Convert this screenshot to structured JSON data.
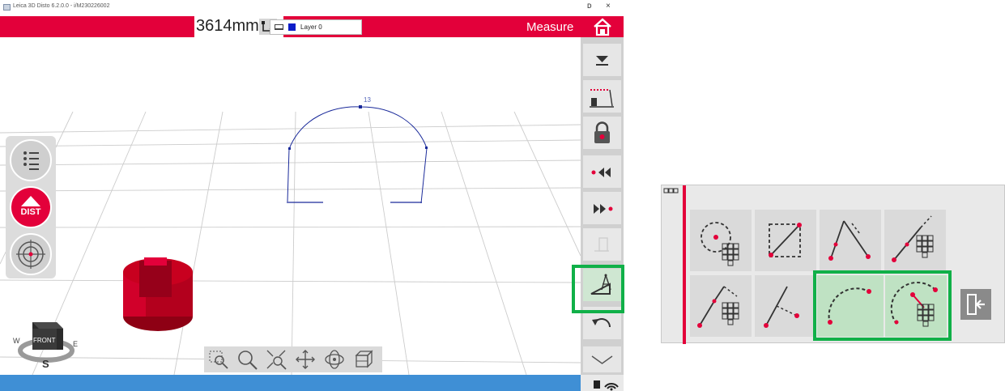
{
  "app": {
    "title": "Leica 3D Disto 6.2.0.0 - i/M230226002",
    "minimize_label": "ᴅ",
    "close_label": "×"
  },
  "header": {
    "distance_value": "3614mm",
    "layer_name": "Layer 0",
    "layer_color": "#0a1dc8",
    "mode_label": "Measure",
    "accent_color": "#e3003a"
  },
  "viewport": {
    "point_label": "13",
    "line_color": "#1a2a9a"
  },
  "left_tools": [
    {
      "icon": "list-icon"
    },
    {
      "icon": "dist-button",
      "label": "DIST"
    },
    {
      "icon": "target-icon"
    }
  ],
  "right_toolbar": [
    {
      "icon": "chevron-down-icon"
    },
    {
      "icon": "height-tracking-icon"
    },
    {
      "icon": "lock-icon"
    },
    {
      "icon": "previous-point-icon"
    },
    {
      "icon": "next-point-icon"
    },
    {
      "icon": "disabled-tool-icon"
    },
    {
      "icon": "measure-tools-icon",
      "highlighted": true
    },
    {
      "icon": "undo-icon"
    },
    {
      "icon": "expand-down-icon"
    }
  ],
  "nav_tools": [
    "zoom-window-icon",
    "zoom-icon",
    "zoom-extents-icon",
    "pan-icon",
    "orbit-icon",
    "view-cube-icon"
  ],
  "compass": {
    "face_label": "FRONT",
    "west": "W",
    "south": "S",
    "east": "E"
  },
  "side_panel": {
    "tools": [
      {
        "icon": "circle-center-grid-icon"
      },
      {
        "icon": "rectangle-diagonal-icon"
      },
      {
        "icon": "angle-icon"
      },
      {
        "icon": "line-grid-icon"
      },
      {
        "icon": "perpendicular-grid-icon"
      },
      {
        "icon": "point-to-line-icon"
      },
      {
        "icon": "arc-icon",
        "selected": true
      },
      {
        "icon": "arc-grid-icon",
        "selected": true
      }
    ],
    "exit_icon": "exit-icon"
  },
  "highlight_color": "#10b048"
}
